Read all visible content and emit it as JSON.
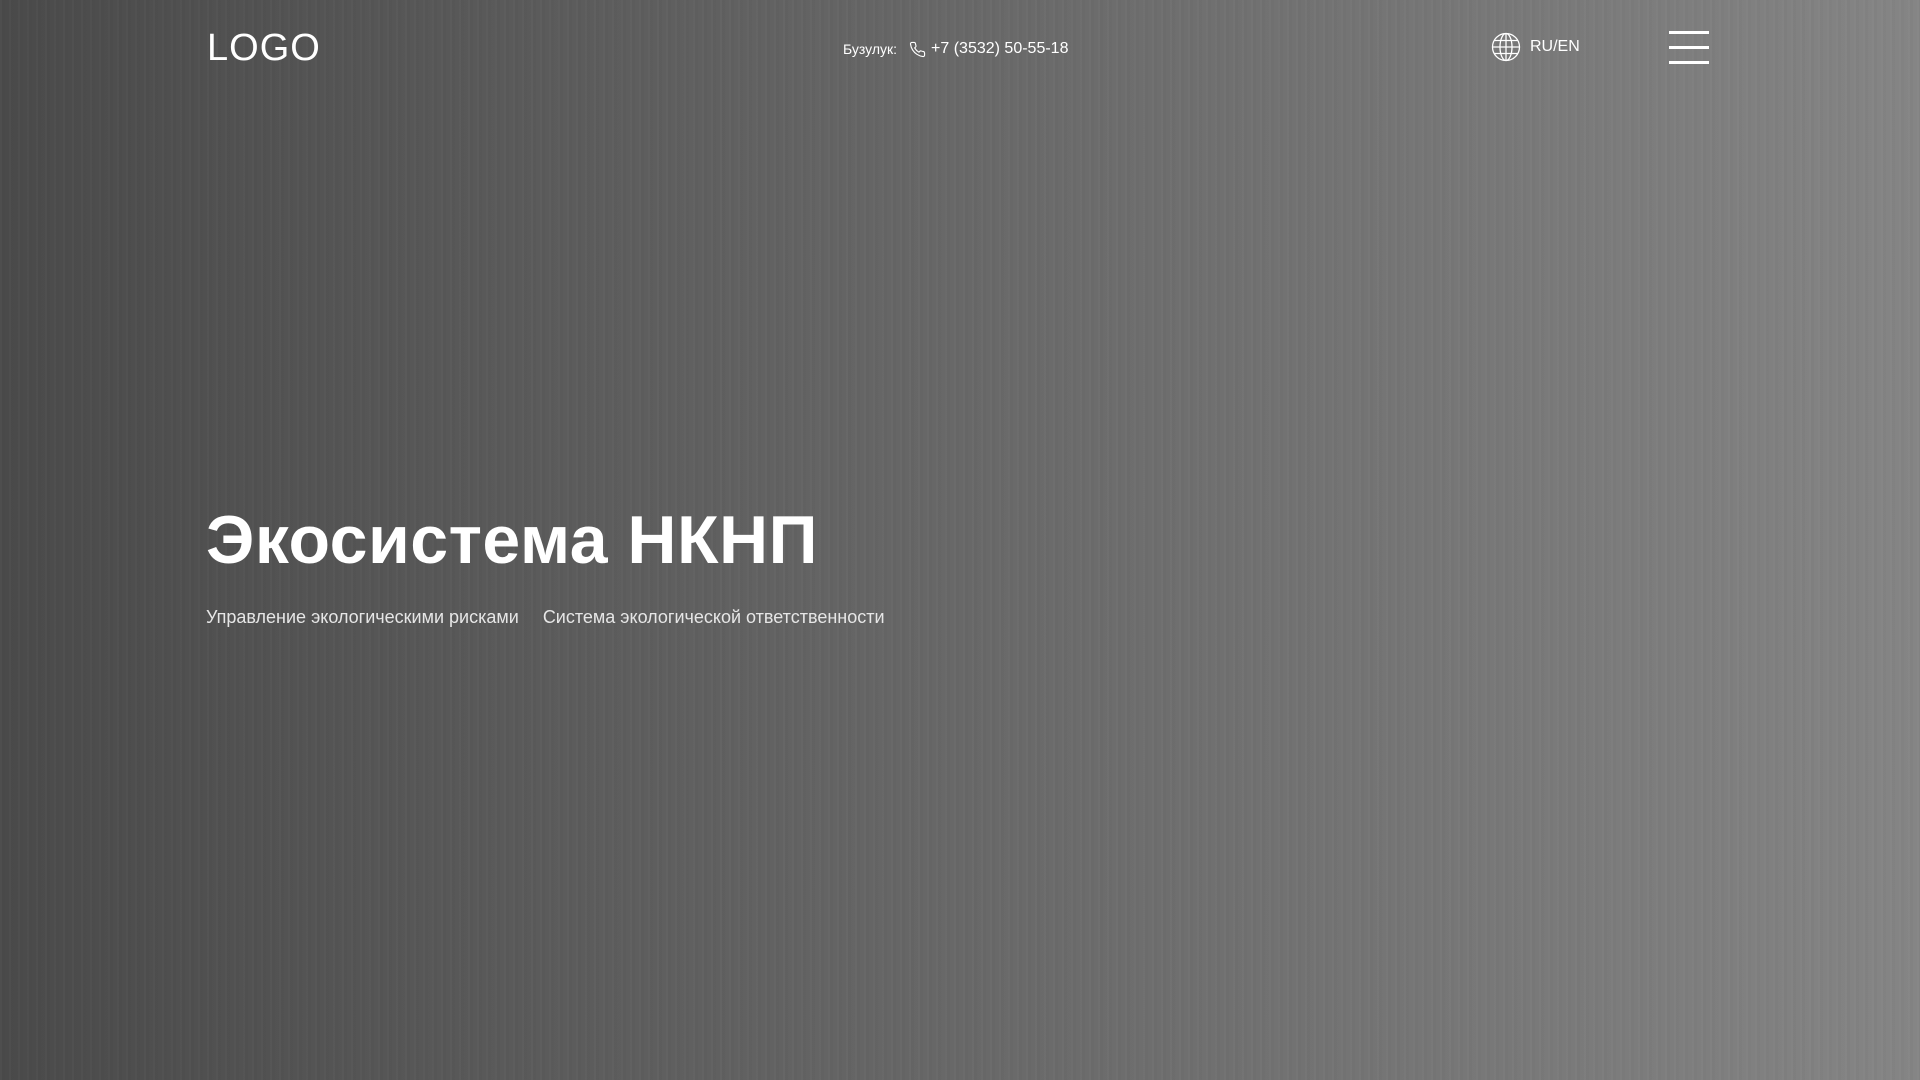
{
  "header": {
    "logo": "LOGO",
    "city_label": "Бузулук:",
    "phone": "+7 (3532) 50-55-18",
    "lang_switch": "RU/EN",
    "icons": {
      "phone": "phone-icon",
      "globe": "globe-icon",
      "menu": "hamburger-menu-icon"
    }
  },
  "hero": {
    "title": "Экосистема НКНП",
    "links": [
      "Управление экологическими рисками",
      "Система экологической ответственности"
    ]
  },
  "colors": {
    "background_left": "#4a4a4a",
    "background_right": "#858585",
    "text": "#ffffff"
  }
}
